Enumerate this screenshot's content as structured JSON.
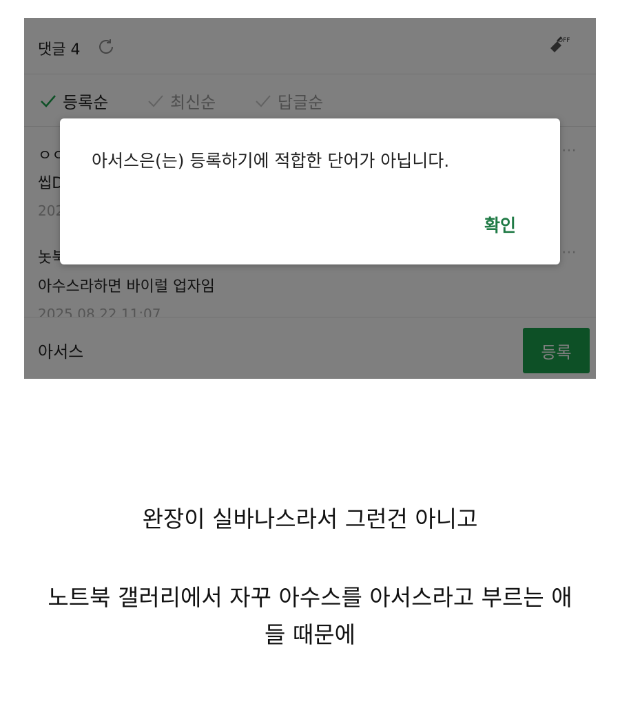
{
  "panel": {
    "comment_header": "댓글 4",
    "sort_options": [
      "등록순",
      "최신순",
      "답글순"
    ],
    "comments": [
      {
        "author": "ㅇㅇ",
        "body": "씹D",
        "date": "202"
      },
      {
        "author": "놋북",
        "body": "아수스라하면 바이럴 업자임",
        "date": "2025.08.22 11:07"
      }
    ],
    "input_value": "아서스",
    "submit_label": "등록",
    "filter_badge": "OFF"
  },
  "dialog": {
    "message": "아서스은(는) 등록하기에 적합한 단어가 아닙니다.",
    "confirm_label": "확인"
  },
  "caption": {
    "line1": "완장이 실바나스라서 그런건 아니고",
    "line2": "노트북 갤러리에서 자꾸 아수스를 아서스라고 부르는 애",
    "line3": "들 때문에"
  },
  "colors": {
    "accent_green": "#1aa14c",
    "confirm_green": "#1f7a45"
  }
}
